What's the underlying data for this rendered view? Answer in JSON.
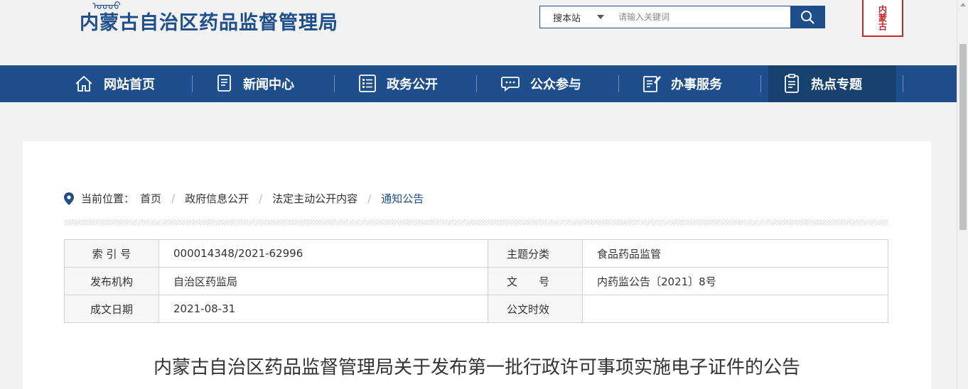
{
  "header": {
    "site_title": "内蒙古自治区药品监督管理局",
    "search": {
      "scope": "搜本站",
      "placeholder": "请输入关键词"
    }
  },
  "nav": {
    "items": [
      {
        "label": "网站首页",
        "icon": "home-icon"
      },
      {
        "label": "新闻中心",
        "icon": "document-icon"
      },
      {
        "label": "政务公开",
        "icon": "list-icon"
      },
      {
        "label": "公众参与",
        "icon": "chat-icon"
      },
      {
        "label": "办事服务",
        "icon": "edit-form-icon"
      },
      {
        "label": "热点专题",
        "icon": "report-icon",
        "active": true
      }
    ]
  },
  "breadcrumb": {
    "prefix": "当前位置：",
    "items": [
      "首页",
      "政府信息公开",
      "法定主动公开内容",
      "通知公告"
    ]
  },
  "meta": {
    "rows": [
      {
        "k1": "索 引 号",
        "v1": "000014348/2021-62996",
        "k2": "主题分类",
        "v2": "食品药品监管"
      },
      {
        "k1": "发布机构",
        "v1": "自治区药监局",
        "k2": "文　　号",
        "v2": "内药监公告〔2021〕8号"
      },
      {
        "k1": "成文日期",
        "v1": "2021-08-31",
        "k2": "公文时效",
        "v2": ""
      }
    ]
  },
  "article": {
    "title": "内蒙古自治区药品监督管理局关于发布第一批行政许可事项实施电子证件的公告"
  },
  "colors": {
    "brand_blue": "#1e4f8c",
    "nav_active": "#17416f",
    "seal_red": "#c62828"
  }
}
